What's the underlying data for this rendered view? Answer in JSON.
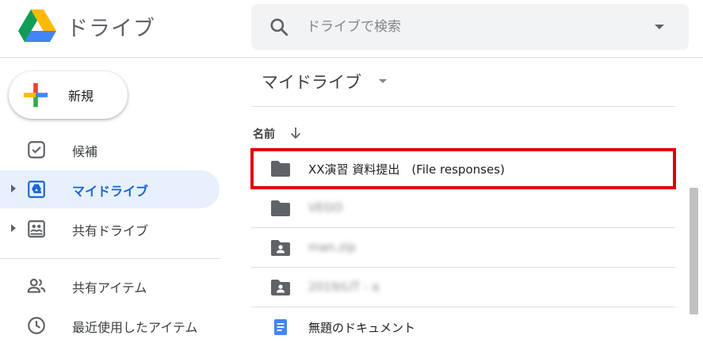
{
  "header": {
    "app_title": "ドライブ",
    "search_placeholder": "ドライブで検索"
  },
  "sidebar": {
    "new_label": "新規",
    "items": [
      {
        "label": "候補",
        "icon": "suggested-icon",
        "active": false
      },
      {
        "label": "マイドライブ",
        "icon": "my-drive-icon",
        "active": true
      },
      {
        "label": "共有ドライブ",
        "icon": "shared-drives-icon",
        "active": false
      },
      {
        "label": "共有アイテム",
        "icon": "shared-with-me-icon",
        "active": false
      },
      {
        "label": "最近使用したアイテム",
        "icon": "recent-icon",
        "active": false
      }
    ]
  },
  "main": {
    "title": "マイドライブ",
    "column_name": "名前",
    "files": [
      {
        "name": "XX演習 資料提出　(File responses)",
        "type": "folder",
        "highlighted": true
      },
      {
        "name": "VEGO",
        "type": "folder",
        "blurred": true
      },
      {
        "name": "man.zip",
        "type": "shared-folder",
        "blurred": true
      },
      {
        "name": "2019/LIT - a",
        "type": "shared-folder",
        "blurred": true
      },
      {
        "name": "無題のドキュメント",
        "type": "document"
      }
    ]
  },
  "colors": {
    "accent": "#1967d2",
    "active_bg": "#e8f0fe",
    "highlight_border": "#e00000",
    "doc_blue": "#4285f4"
  }
}
